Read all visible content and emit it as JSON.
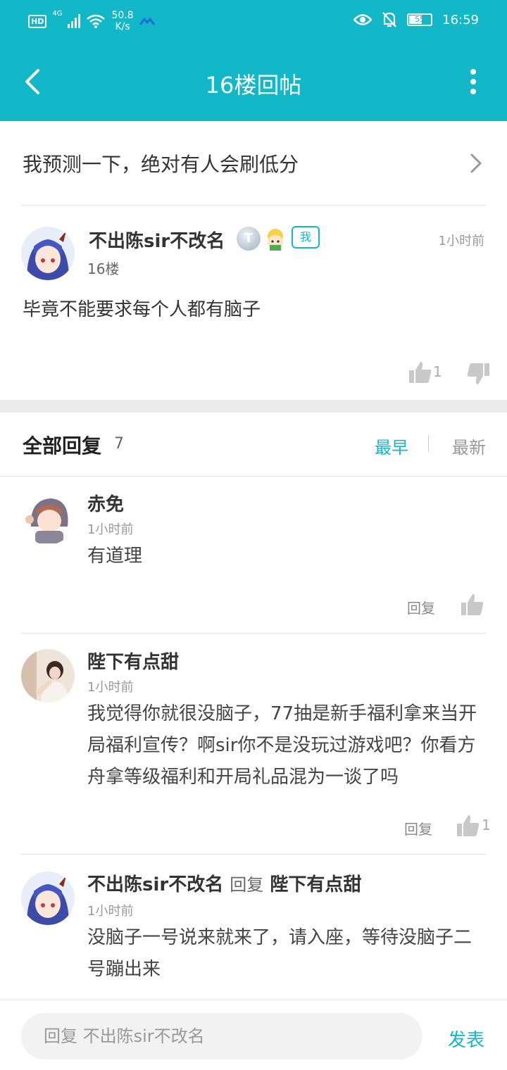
{
  "status_bar": {
    "hd": "HD",
    "network": "4G",
    "speed_value": "50.8",
    "speed_unit": "K/s",
    "battery": "55",
    "time": "16:59"
  },
  "header": {
    "title": "16楼回帖"
  },
  "topic": {
    "text": "我预测一下，绝对有人会刷低分"
  },
  "post": {
    "username": "不出陈sir不改名",
    "badge_t": "T",
    "badge_me": "我",
    "time": "1小时前",
    "floor": "16楼",
    "content": "毕竟不能要求每个人都有脑子",
    "likes": "1"
  },
  "replies_header": {
    "title": "全部回复",
    "count": "7",
    "sort_earliest": "最早",
    "sort_newest": "最新"
  },
  "replies": [
    {
      "name": "赤免",
      "time": "1小时前",
      "body": "有道理",
      "reply_label": "回复",
      "likes": ""
    },
    {
      "name": "陛下有点甜",
      "time": "1小时前",
      "body": "我觉得你就很没脑子，77抽是新手福利拿来当开局福利宣传？啊sir你不是没玩过游戏吧？你看方舟拿等级福利和开局礼品混为一谈了吗",
      "reply_label": "回复",
      "likes": "1"
    },
    {
      "name": "不出陈sir不改名",
      "reply_word": "回复",
      "reply_to": "陛下有点甜",
      "time": "1小时前",
      "body": "没脑子一号说来就来了，请入座，等待没脑子二号蹦出来"
    }
  ],
  "composer": {
    "placeholder": "回复 不出陈sir不改名",
    "send_label": "发表"
  },
  "colors": {
    "accent": "#13b8c8",
    "band": "#ebebeb"
  }
}
